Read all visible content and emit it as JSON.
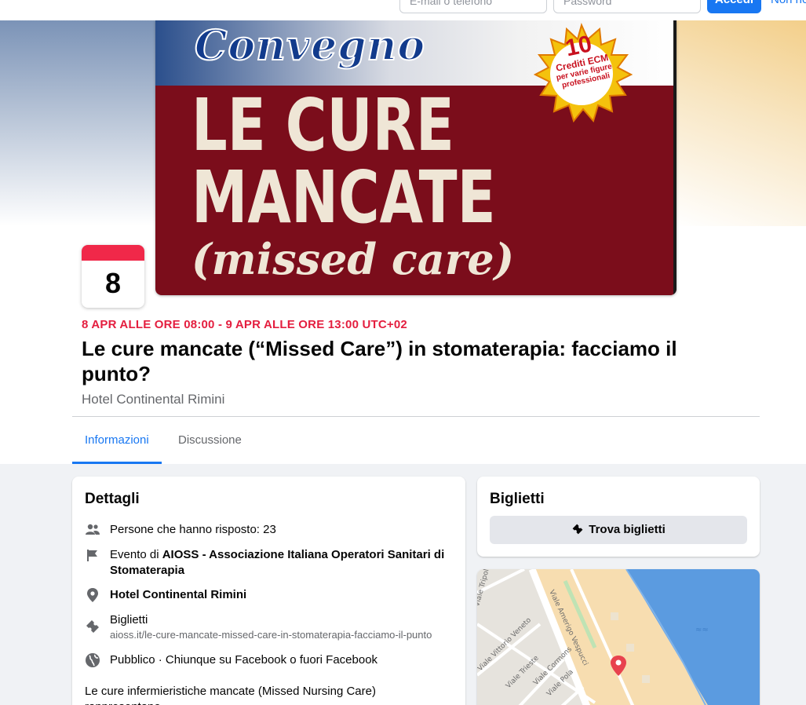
{
  "login": {
    "email_placeholder": "E-mail o telefono",
    "password_placeholder": "Password",
    "login_button": "Accedi",
    "forgot_link": "Non ricordi"
  },
  "poster": {
    "convegno": "Convegno",
    "main_line1": "LE CURE",
    "main_line2": "MANCATE",
    "missed": "(missed care)",
    "badge_number": "10",
    "badge_line1": "Crediti ECM",
    "badge_line2": "per varie figure",
    "badge_line3": "professionali"
  },
  "event": {
    "calendar_day": "8",
    "date_range": "8 APR ALLE ORE 08:00 - 9 APR ALLE ORE 13:00 UTC+02",
    "title": "Le cure mancate (“Missed Care”) in stomaterapia: facciamo il punto?",
    "place": "Hotel Continental Rimini"
  },
  "tabs": [
    {
      "label": "Informazioni",
      "active": true
    },
    {
      "label": "Discussione",
      "active": false
    }
  ],
  "details": {
    "title": "Dettagli",
    "responded": "Persone che hanno risposto: 23",
    "event_by_prefix": "Evento di ",
    "organizer": "AIOSS - Associazione Italiana Operatori Sanitari di Stomaterapia",
    "location": "Hotel Continental Rimini",
    "tickets_label": "Biglietti",
    "tickets_url": "aioss.it/le-cure-mancate-missed-care-in-stomaterapia-facciamo-il-punto",
    "privacy": "Pubblico · Chiunque su Facebook o fuori Facebook",
    "description": "Le cure infermieristiche mancate (Missed Nursing Care) rappresentano"
  },
  "tickets_card": {
    "title": "Biglietti",
    "button": "Trova biglietti"
  },
  "map": {
    "street_1": "Viale Amerigo Vespucci",
    "street_2": "Viale Vittorio Veneto",
    "street_3": "Viale Trieste",
    "street_4": "Viale Cormons",
    "street_5": "Viale Pola",
    "street_6": "Viale Tripoli"
  },
  "colors": {
    "accent": "#1877f2",
    "date_red": "#e41e3f",
    "pin_red": "#e8424e",
    "sea": "#5b9be0"
  }
}
